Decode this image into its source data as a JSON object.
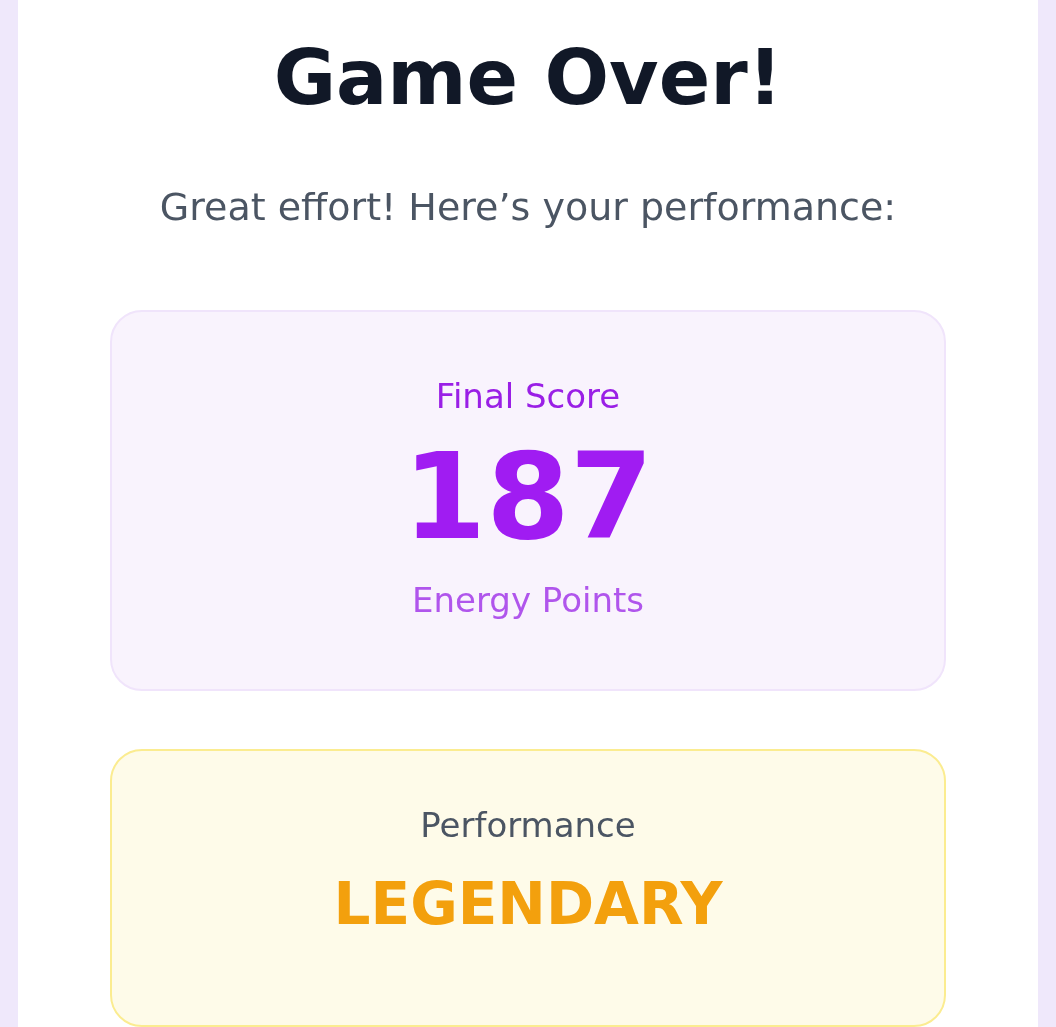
{
  "title": "Game Over!",
  "subtitle": "Great effort! Here’s your performance:",
  "score": {
    "label": "Final Score",
    "value": "187",
    "unit": "Energy Points"
  },
  "performance": {
    "label": "Performance",
    "rating": "LEGENDARY"
  }
}
